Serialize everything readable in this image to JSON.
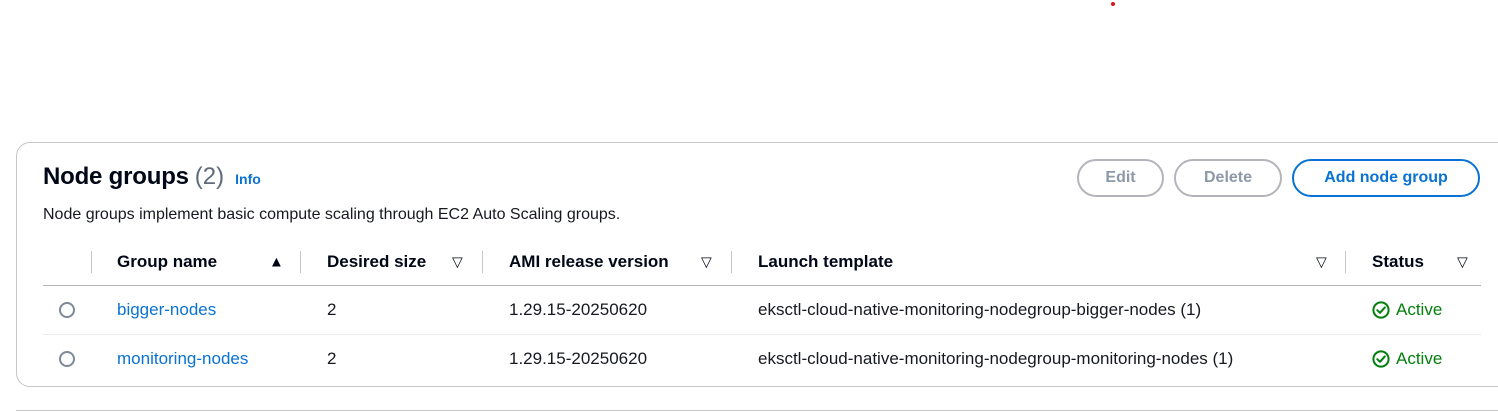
{
  "panel": {
    "title": "Node groups",
    "count": "(2)",
    "info_label": "Info",
    "description": "Node groups implement basic compute scaling through EC2 Auto Scaling groups."
  },
  "actions": {
    "edit_label": "Edit",
    "delete_label": "Delete",
    "add_label": "Add node group"
  },
  "table": {
    "columns": [
      "Group name",
      "Desired size",
      "AMI release version",
      "Launch template",
      "Status"
    ],
    "rows": [
      {
        "group_name": "bigger-nodes",
        "desired_size": "2",
        "ami_release_version": "1.29.15-20250620",
        "launch_template": "eksctl-cloud-native-monitoring-nodegroup-bigger-nodes (1)",
        "status": "Active"
      },
      {
        "group_name": "monitoring-nodes",
        "desired_size": "2",
        "ami_release_version": "1.29.15-20250620",
        "launch_template": "eksctl-cloud-native-monitoring-nodegroup-monitoring-nodes (1)",
        "status": "Active"
      }
    ]
  },
  "colors": {
    "link": "#0972d3",
    "status_active": "#037f0c",
    "disabled_text": "#8d99a8"
  },
  "icons": {
    "sort_ascending": "sort-ascending-icon",
    "sort_unsorted": "sort-icon",
    "status_active": "check-circle-icon"
  }
}
